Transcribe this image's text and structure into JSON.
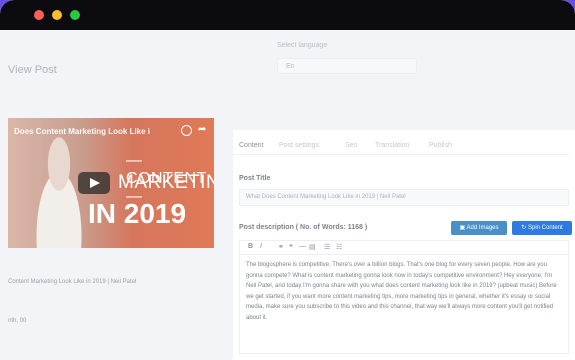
{
  "window": {
    "title": "View Post"
  },
  "language": {
    "label": "Select language",
    "value": "En"
  },
  "video": {
    "overlay_title": "Does Content Marketing Look Like i",
    "line1": "—CONTENT—",
    "line2": "MARKETING",
    "line3": "IN 2019",
    "caption": "Content Marketing Look Like in 2019 | Neil Patel",
    "meta": "nth, 00"
  },
  "tabs": [
    "Content",
    "Post settings",
    "Seo",
    "Translation",
    "Publish"
  ],
  "post_title": {
    "label": "Post Title",
    "value": "What Does Content Marketing Look Like in 2019 | Neil Patel"
  },
  "description": {
    "label": "Post description ( No. of Words: 1168 )"
  },
  "buttons": {
    "add_images": "Add Images",
    "spin_content": "Spin Content"
  },
  "toolbar": [
    "B",
    "I",
    "⚭",
    "❝",
    "—",
    "▤",
    "☰",
    "☷"
  ],
  "editor_text": "The blogosphere is competitive. There's over a billion blogs. That's one blog for every seven people. How are you gonna compete? What is content marketing gonna look now in today's competitive environment? Hey everyone, I'm Neil Patel, and today I'm gonna share with you what does content marketing look like in 2019? (upbeat music) Before we get started, if you want more content marketing tips, more marketing tips in general, whether it's essay or social media, make sure you subscribe to this video and this channel, that way we'll always more content you'll get notified about it.",
  "colors": {
    "accent": "#2d7be0",
    "background": "#6b4fe0"
  }
}
